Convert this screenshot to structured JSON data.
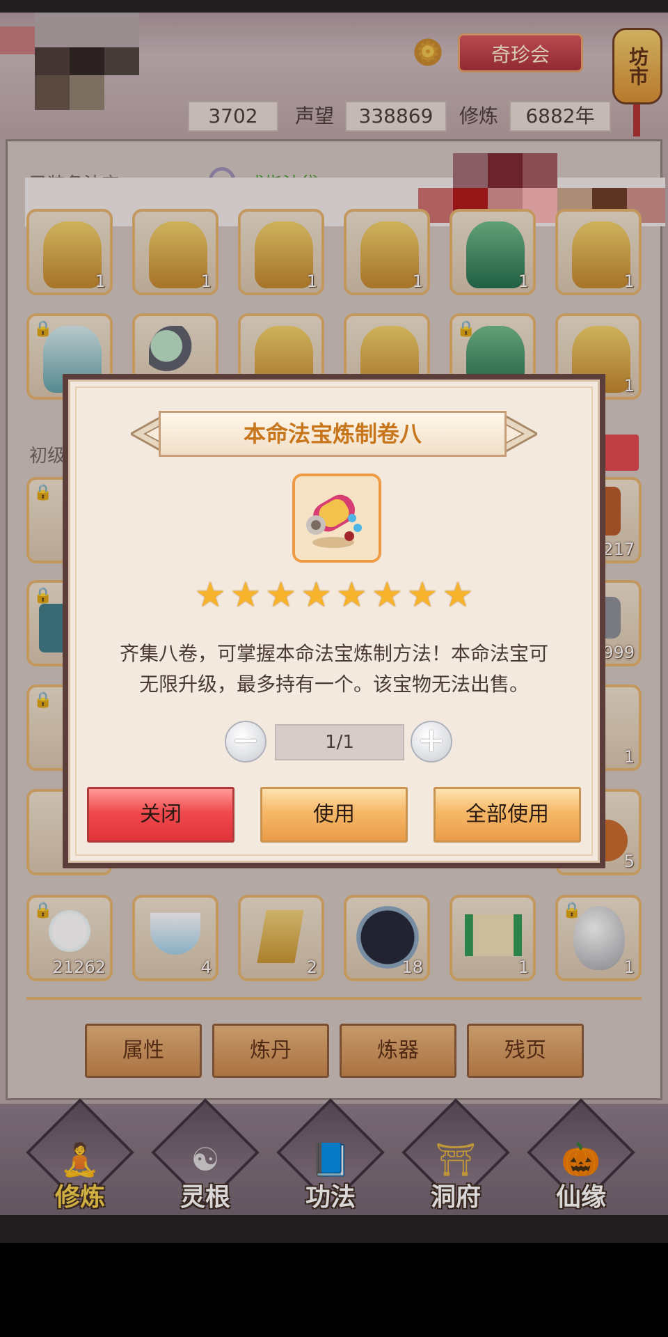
{
  "header": {
    "qizhenhui_label": "奇珍会",
    "fangshi_label": "坊市",
    "stat1_value": "3702",
    "stat2_label": "声望",
    "stat2_value": "338869",
    "stat3_label": "修炼",
    "stat3_value": "6882年"
  },
  "equipped": {
    "title": "已装备法宝",
    "ring_link": "戒指法袋",
    "slots": [
      {
        "count": "1"
      },
      {
        "count": "1"
      },
      {
        "count": "1"
      },
      {
        "count": "1"
      },
      {
        "count": "1"
      },
      {
        "count": "1"
      },
      {
        "count": ""
      },
      {
        "count": ""
      },
      {
        "count": ""
      },
      {
        "count": ""
      },
      {
        "count": ""
      },
      {
        "count": "1"
      }
    ]
  },
  "inventory": {
    "title": "初级",
    "visible_counts_right": [
      "217",
      "999",
      "1",
      "5"
    ],
    "bottom_row": [
      {
        "count": "21262",
        "icon": "snowman-icon"
      },
      {
        "count": "4",
        "icon": "tea-cup-icon"
      },
      {
        "count": "2",
        "icon": "scroll-paper-icon"
      },
      {
        "count": "18",
        "icon": "star-disc-icon"
      },
      {
        "count": "1",
        "icon": "scroll-icon"
      },
      {
        "count": "1",
        "icon": "egg-icon"
      }
    ]
  },
  "tabs": [
    "属性",
    "炼丹",
    "炼器",
    "残页"
  ],
  "nav": [
    {
      "label": "修炼",
      "icon": "cultivator-icon",
      "active": true
    },
    {
      "label": "灵根",
      "icon": "spirit-root-icon",
      "active": false
    },
    {
      "label": "功法",
      "icon": "book-icon",
      "active": false
    },
    {
      "label": "洞府",
      "icon": "pavilion-icon",
      "active": false
    },
    {
      "label": "仙缘",
      "icon": "gourd-icon",
      "active": false
    }
  ],
  "modal": {
    "title": "本命法宝炼制卷八",
    "star_count": 8,
    "description_line1": "齐集八卷，可掌握本命法宝炼制方法！本命法宝可",
    "description_line2": "无限升级，最多持有一个。该宝物无法出售。",
    "quantity": "1/1",
    "minus": "−",
    "plus": "+",
    "close_label": "关闭",
    "use_label": "使用",
    "use_all_label": "全部使用"
  }
}
